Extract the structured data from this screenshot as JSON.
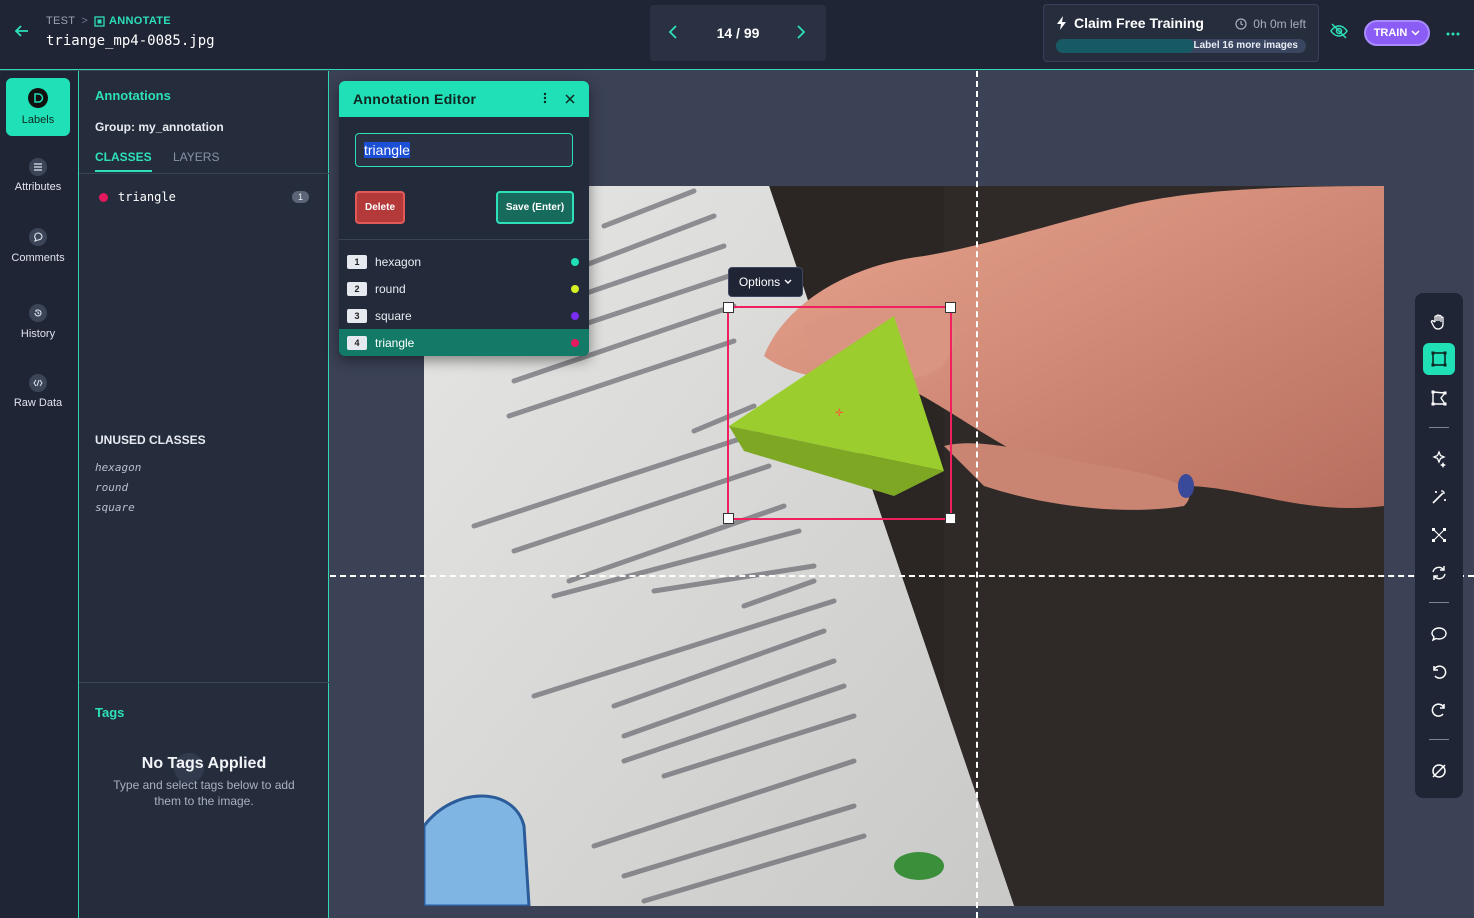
{
  "header": {
    "crumb_project": "TEST",
    "crumb_separator": ">",
    "crumb_section": "ANNOTATE",
    "filename": "triange_mp4-0085.jpg",
    "pager_text": "14 / 99",
    "claim_title": "Claim Free Training",
    "claim_time": "0h 0m left",
    "claim_progress_label": "Label 16 more images",
    "claim_progress_fraction": 0.55,
    "train_label": "TRAIN",
    "accent_color": "#1fe0b6",
    "train_color": "#8b5cf6"
  },
  "rail": {
    "items": [
      {
        "label": "Labels",
        "icon": "labels-icon"
      },
      {
        "label": "Attributes",
        "icon": "list-icon"
      },
      {
        "label": "Comments",
        "icon": "comment-icon"
      },
      {
        "label": "History",
        "icon": "history-icon"
      },
      {
        "label": "Raw Data",
        "icon": "code-icon"
      }
    ]
  },
  "panel": {
    "title": "Annotations",
    "group": "Group: my_annotation",
    "tab_classes": "CLASSES",
    "tab_layers": "LAYERS",
    "class_name": "triangle",
    "class_count": "1",
    "class_color": "#e5195f",
    "unused_title": "UNUSED CLASSES",
    "unused": [
      "hexagon",
      "round",
      "square"
    ],
    "tags_title": "Tags",
    "no_tags_title": "No Tags Applied",
    "no_tags_text": "Type and select tags below to add them to the image."
  },
  "editor": {
    "title": "Annotation Editor",
    "input_value": "triangle",
    "delete_label": "Delete",
    "save_label": "Save (Enter)",
    "options": [
      {
        "num": "1",
        "name": "hexagon",
        "color": "#1fe0b6"
      },
      {
        "num": "2",
        "name": "round",
        "color": "#d4f01f"
      },
      {
        "num": "3",
        "name": "square",
        "color": "#7a2cf0"
      },
      {
        "num": "4",
        "name": "triangle",
        "color": "#e5195f",
        "selected": true
      }
    ]
  },
  "canvas": {
    "options_label": "Options"
  }
}
